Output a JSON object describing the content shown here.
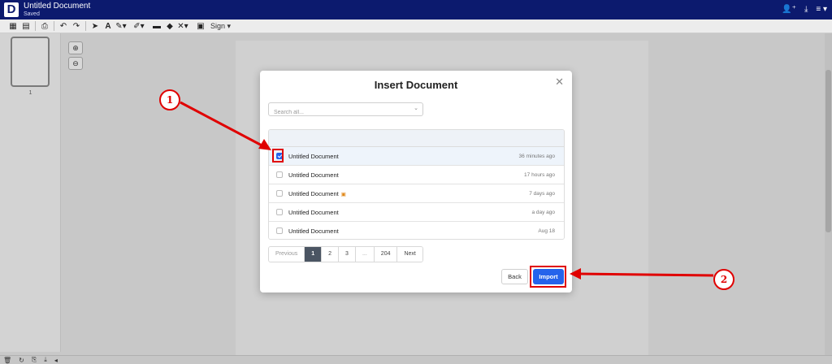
{
  "header": {
    "logo": "D",
    "title": "Untitled Document",
    "status": "Saved",
    "icons": [
      "add-user-icon",
      "download-icon",
      "menu-icon"
    ]
  },
  "toolbar": {
    "icons": [
      "grid-icon",
      "list-icon",
      "print-icon",
      "undo-icon",
      "redo-icon",
      "pointer-icon",
      "text-icon",
      "pen-icon",
      "highlighter-icon",
      "comment-icon",
      "eraser-icon",
      "cross-icon",
      "image-icon"
    ],
    "sign_label": "Sign ▾"
  },
  "sidebar": {
    "page_number": "1"
  },
  "modal": {
    "title": "Insert Document",
    "search_placeholder": "Search all...",
    "documents": [
      {
        "name": "Untitled Document",
        "time": "36 minutes ago",
        "checked": true,
        "locked": false
      },
      {
        "name": "Untitled Document",
        "time": "17 hours ago",
        "checked": false,
        "locked": false
      },
      {
        "name": "Untitled Document",
        "time": "7 days ago",
        "checked": false,
        "locked": true
      },
      {
        "name": "Untitled Document",
        "time": "a day ago",
        "checked": false,
        "locked": false
      },
      {
        "name": "Untitled Document",
        "time": "Aug 18",
        "checked": false,
        "locked": false
      }
    ],
    "pagination": {
      "previous": "Previous",
      "pages": [
        "1",
        "2",
        "3",
        "...",
        "204"
      ],
      "next": "Next",
      "current": "1"
    },
    "back_label": "Back",
    "import_label": "Import"
  },
  "annotations": {
    "step1": "1",
    "step2": "2",
    "color": "#e00000"
  },
  "colors": {
    "header_bg": "#0c1a6e",
    "primary": "#2563eb",
    "active_page": "#4b5563"
  }
}
